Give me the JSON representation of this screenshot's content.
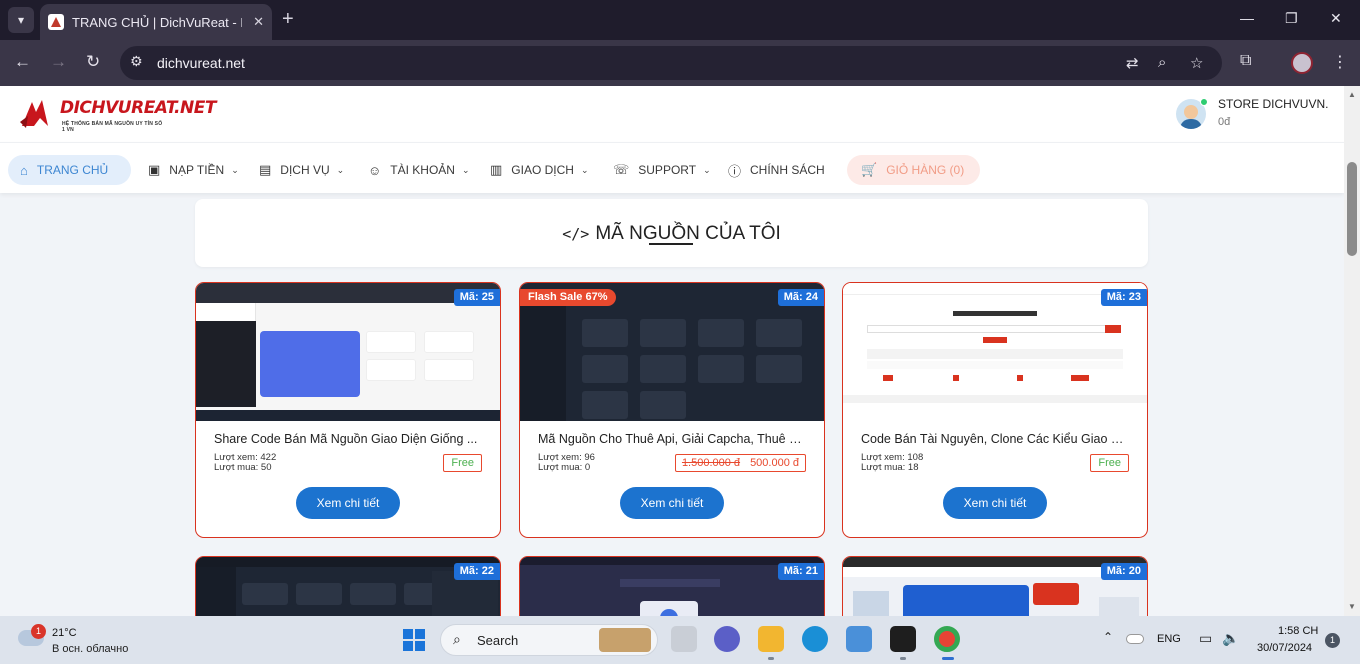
{
  "browser": {
    "tab_title": "TRANG CHỦ | DichVuReat - Hệ",
    "url": "dichvureat.net"
  },
  "site": {
    "logo_text": "DICHVUREAT.NET",
    "logo_subtitle": "HỆ THỐNG BÁN MÃ NGUỒN UY TÍN SỐ 1 VN",
    "user_name": "STORE DICHVUVN.",
    "user_balance": "0đ"
  },
  "nav": {
    "home": "TRANG CHỦ",
    "topup": "NẠP TIỀN",
    "services": "DỊCH VỤ",
    "account": "TÀI KHOẢN",
    "transactions": "GIAO DỊCH",
    "support": "SUPPORT",
    "policy": "CHÍNH SÁCH",
    "cart": "GIỎ HÀNG (0)"
  },
  "section": {
    "title": "MÃ NGUỒN CỦA TÔI"
  },
  "cards": [
    {
      "code": "Mã: 25",
      "title": "Share Code Bán Mã Nguồn Giao Diện Giống ...",
      "views": "Lượt xem: 422",
      "buys": "Lượt mua: 50",
      "price": "Free",
      "button": "Xem chi tiết"
    },
    {
      "code": "Mã: 24",
      "flash": "Flash Sale 67%",
      "title": "Mã Nguồn Cho Thuê Api, Giải Capcha, Thuê C...",
      "views": "Lượt xem: 96",
      "buys": "Lượt mua: 0",
      "old_price": "1.500.000 đ",
      "new_price": "500.000 đ",
      "button": "Xem chi tiết"
    },
    {
      "code": "Mã: 23",
      "title": "Code Bán Tài Nguyên, Clone Các Kiểu Giao Di...",
      "views": "Lượt xem: 108",
      "buys": "Lượt mua: 18",
      "price": "Free",
      "button": "Xem chi tiết"
    },
    {
      "code": "Mã: 22"
    },
    {
      "code": "Mã: 21"
    },
    {
      "code": "Mã: 20"
    }
  ],
  "taskbar": {
    "weather_badge": "1",
    "temp": "21°C",
    "condition": "В осн. облачно",
    "search": "Search",
    "lang": "ENG",
    "time": "1:58 CH",
    "date": "30/07/2024",
    "notifications": "1"
  },
  "colors": {
    "accent_blue": "#1c73cf",
    "brand_red": "#c8161d",
    "flash_red": "#e8492e"
  }
}
